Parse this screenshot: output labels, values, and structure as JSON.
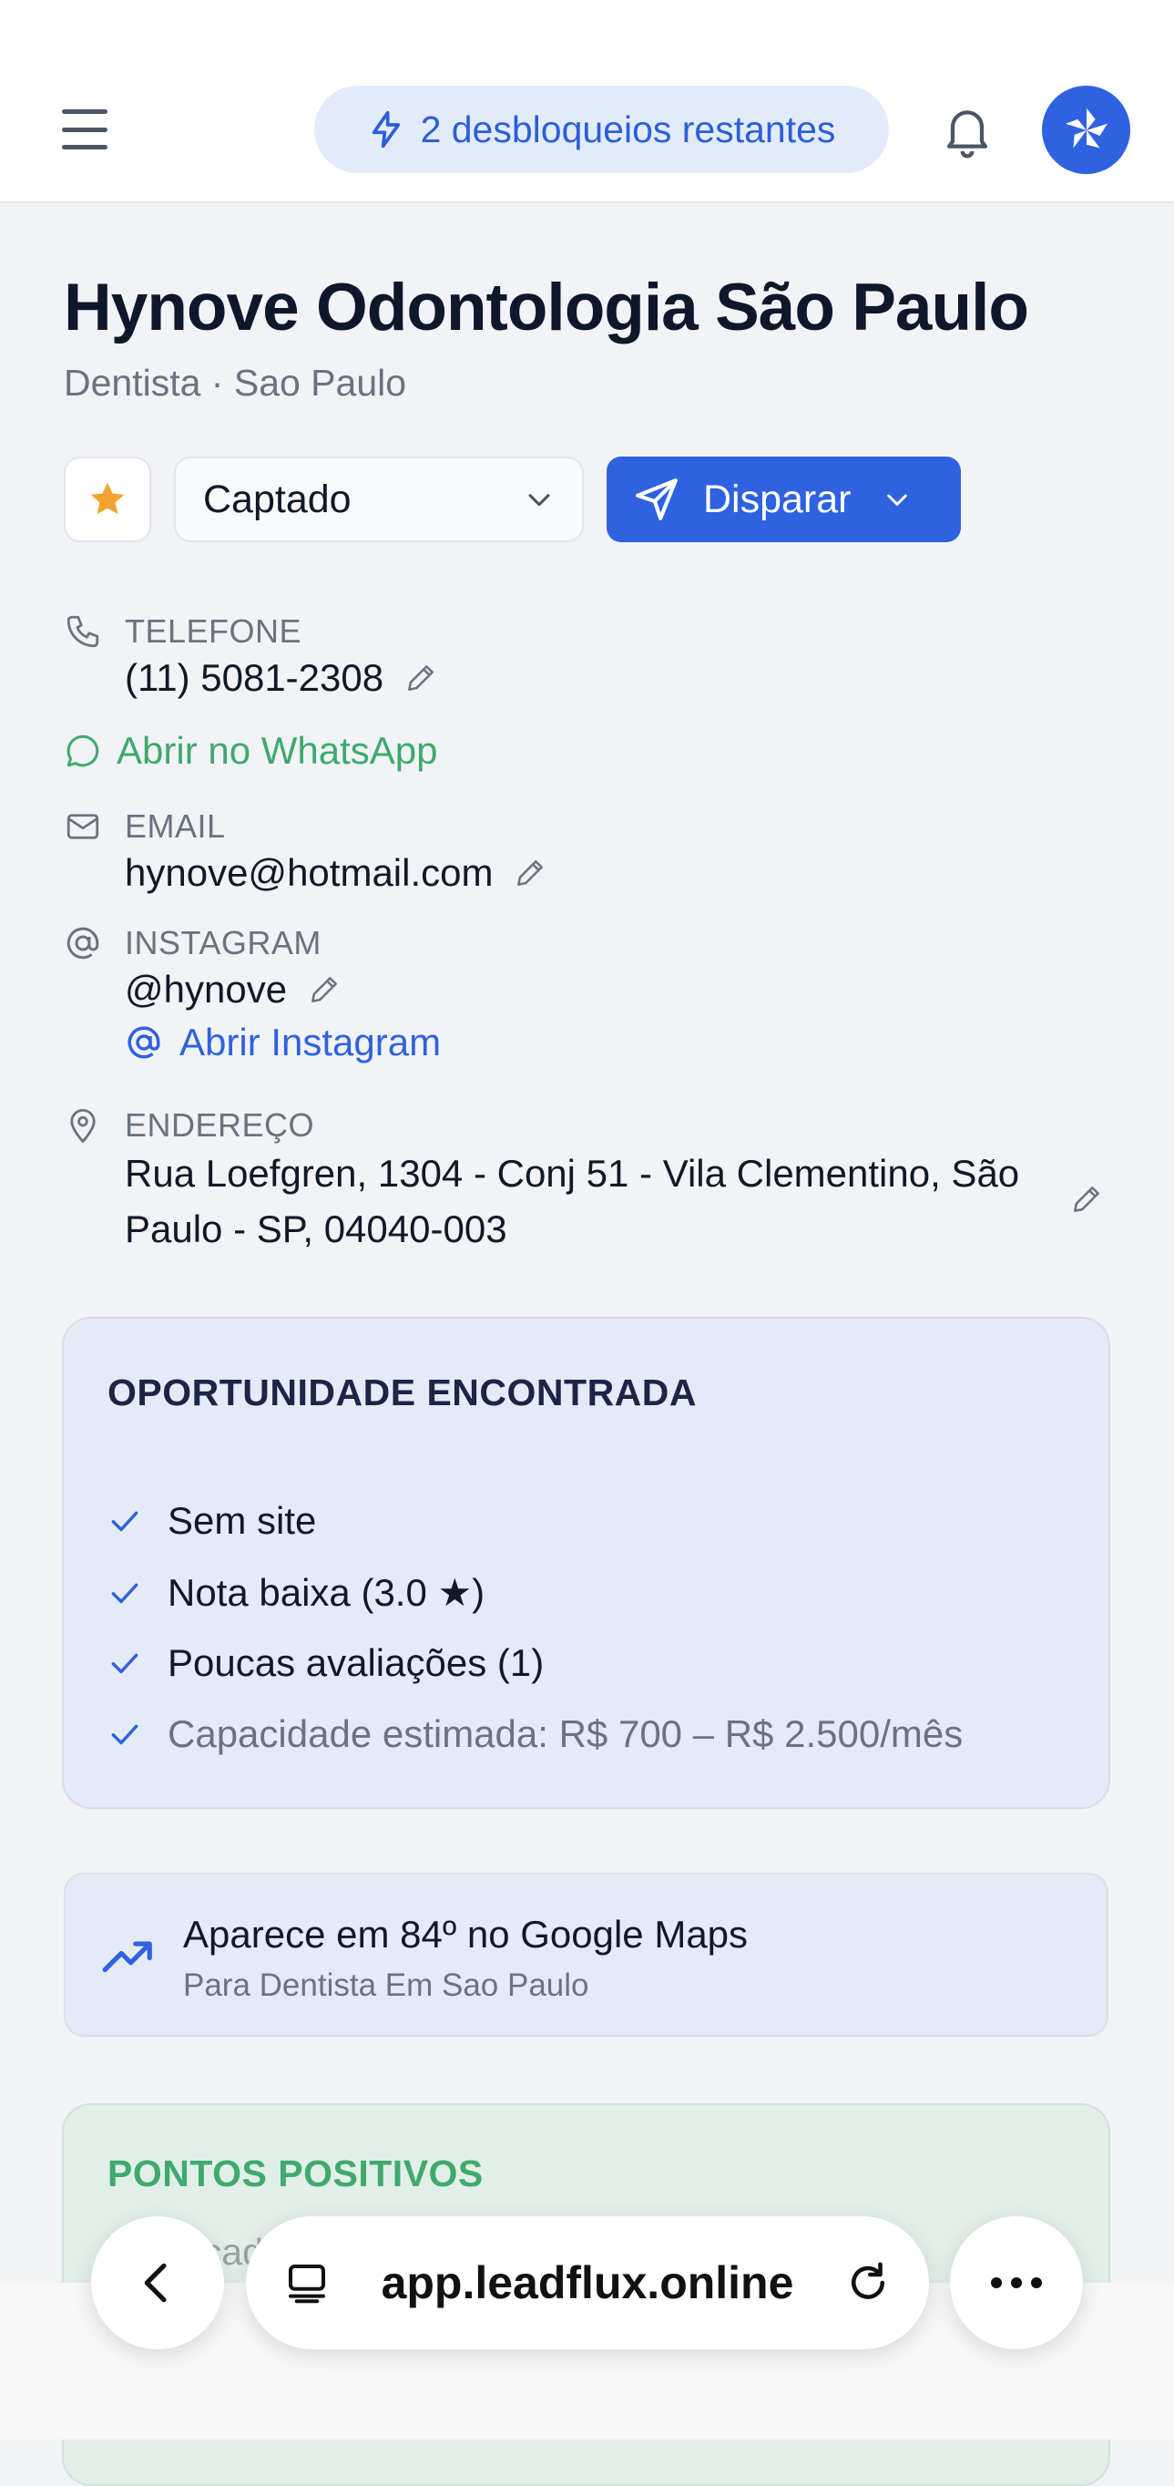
{
  "header": {
    "unlocks_label": "2 desbloqueios restantes"
  },
  "business": {
    "name": "Hynove Odontologia São Paulo",
    "subtitle": "Dentista · Sao Paulo"
  },
  "actions": {
    "status_value": "Captado",
    "fire_label": "Disparar"
  },
  "contact": {
    "phone_label": "TELEFONE",
    "phone_value": "(11) 5081-2308",
    "whatsapp_link": "Abrir no WhatsApp",
    "email_label": "EMAIL",
    "email_value": "hynove@hotmail.com",
    "instagram_label": "INSTAGRAM",
    "instagram_value": "@hynove",
    "instagram_link": "Abrir Instagram",
    "address_label": "ENDEREÇO",
    "address_value": "Rua Loefgren, 1304 - Conj 51 - Vila Clementino, São Paulo - SP, 04040-003"
  },
  "opportunity": {
    "title": "OPORTUNIDADE ENCONTRADA",
    "items": [
      "Sem site",
      "Nota baixa (3.0 ★)",
      "Poucas avaliações (1)",
      "Capacidade estimada: R$ 700 – R$ 2.500/mês"
    ]
  },
  "ranking": {
    "title": "Aparece em 84º no Google Maps",
    "subtitle": "Para Dentista Em Sao Paulo"
  },
  "positives": {
    "title": "PONTOS POSITIVOS",
    "first_item": "Perfil cadastrado facilita descoberta local"
  },
  "browser": {
    "url": "app.leadflux.online"
  },
  "colors": {
    "accent": "#2f62e0",
    "success": "#3faa6c",
    "star": "#f3a230"
  }
}
